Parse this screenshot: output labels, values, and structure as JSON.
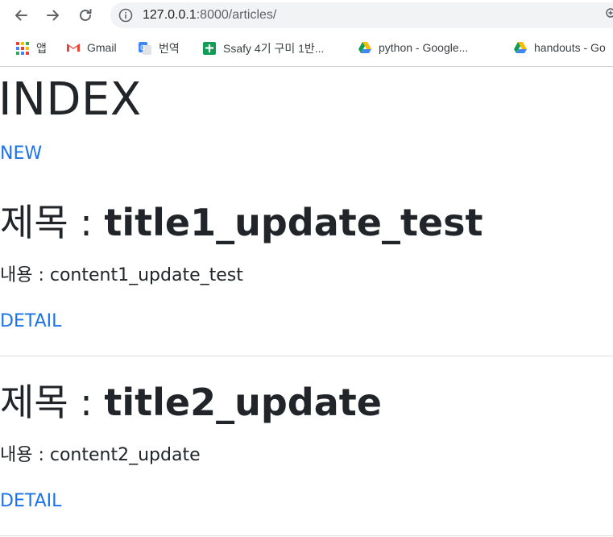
{
  "browser": {
    "url_host": "127.0.0.1",
    "url_rest": ":8000/articles/",
    "bookmarks": [
      {
        "label": "앱",
        "icon": "apps-grid-icon"
      },
      {
        "label": "Gmail",
        "icon": "gmail-icon"
      },
      {
        "label": "번역",
        "icon": "google-translate-icon"
      },
      {
        "label": "Ssafy 4기 구미 1반...",
        "icon": "google-sheets-icon"
      },
      {
        "label": "python - Google...",
        "icon": "google-drive-icon"
      },
      {
        "label": "handouts - Go",
        "icon": "google-drive-icon"
      }
    ]
  },
  "page": {
    "title": "INDEX",
    "new_link": "NEW",
    "articles": [
      {
        "title_prefix": "제목 : ",
        "title": "title1_update_test",
        "content": "내용 : content1_update_test",
        "detail_link": "DETAIL"
      },
      {
        "title_prefix": "제목 : ",
        "title": "title2_update",
        "content": "내용 : content2_update",
        "detail_link": "DETAIL"
      }
    ]
  },
  "colors": {
    "link": "#1a73e8",
    "text": "#212529",
    "divider": "#dcdcdc"
  }
}
